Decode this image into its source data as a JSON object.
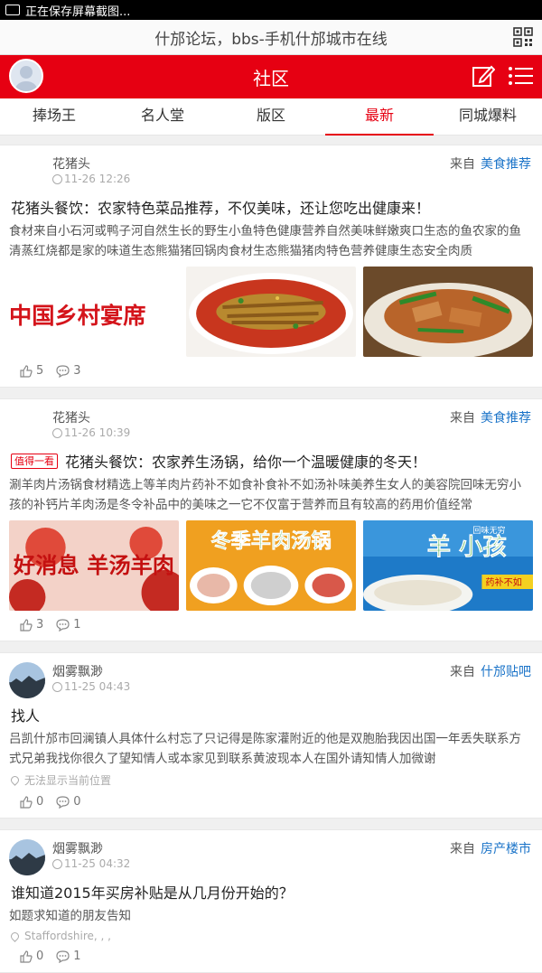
{
  "statusbar": {
    "text": "正在保存屏幕截图..."
  },
  "browser": {
    "title": "什邡论坛，bbs-手机什邡城市在线"
  },
  "header": {
    "title": "社区"
  },
  "tabs": [
    {
      "label": "捧场王"
    },
    {
      "label": "名人堂"
    },
    {
      "label": "版区"
    },
    {
      "label": "最新",
      "active": true
    },
    {
      "label": "同城爆料"
    }
  ],
  "posts": [
    {
      "author": "花猪头",
      "time": "11-26 12:26",
      "from": "来自",
      "category": "美食推荐",
      "title": "花猪头餐饮：农家特色菜品推荐，不仅美味，还让您吃出健康来！",
      "body": "食材来自小石河或鸭子河自然生长的野生小鱼特色健康营养自然美味鲜嫩爽口生态的鱼农家的鱼清蒸红烧都是家的味道生态熊猫猪回锅肉食材生态熊猫猪肉特色营养健康生态安全肉质",
      "image1_text": "中国乡村宴席",
      "likes": "5",
      "comments": "3"
    },
    {
      "author": "花猪头",
      "time": "11-26 10:39",
      "from": "来自",
      "category": "美食推荐",
      "badge": "值得一看",
      "title": "花猪头餐饮：农家养生汤锅，给你一个温暖健康的冬天！",
      "body": "涮羊肉片汤锅食材精选上等羊肉片药补不如食补食补不如汤补味美养生女人的美容院回味无穷小孩的补钙片羊肉汤是冬令补品中的美味之一它不仅富于营养而且有较高的药用价值经常",
      "image1_text": "好消息 羊汤羊肉",
      "image2_text": "冬季羊肉汤锅",
      "image3_text": "羊 小孩",
      "image3_sub": "回味无穷",
      "image3_sub2": "药补不如",
      "likes": "3",
      "comments": "1"
    },
    {
      "author": "烟雾飘渺",
      "time": "11-25 04:43",
      "from": "来自",
      "category": "什邡贴吧",
      "title": "找人",
      "body": "吕凯什邡市回澜镇人具体什么村忘了只记得是陈家灌附近的他是双胞胎我因出国一年丢失联系方式兄弟我找你很久了望知情人或本家见到联系黄波现本人在国外请知情人加微谢",
      "location": "无法显示当前位置",
      "likes": "0",
      "comments": "0"
    },
    {
      "author": "烟雾飘渺",
      "time": "11-25 04:32",
      "from": "来自",
      "category": "房产楼市",
      "title": "谁知道2015年买房补贴是从几月份开始的？",
      "body": "如题求知道的朋友告知",
      "location": "Staffordshire, , ,",
      "likes": "0",
      "comments": "1"
    }
  ],
  "colors": {
    "brand": "#e60012",
    "link": "#1a73c8"
  }
}
